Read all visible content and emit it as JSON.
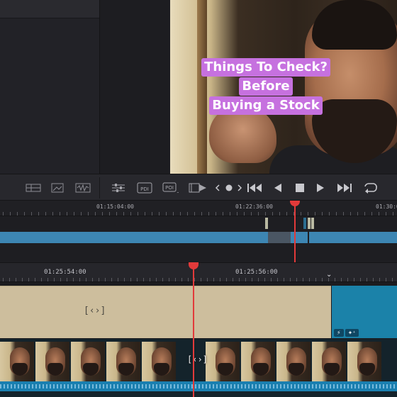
{
  "viewer": {
    "caption_lines": [
      "Things To Check?",
      "Before",
      "Buying a Stock"
    ]
  },
  "toolbar": {
    "left_icons": [
      "layout-icon",
      "image-icon",
      "waveform-icon"
    ],
    "center_icons": [
      "sliders-icon",
      "pdi-icon",
      "poi-icon",
      "film-play-icon"
    ],
    "transport": [
      "prev-marker-icon",
      "marker-dot-icon",
      "next-marker-icon",
      "go-to-start-icon",
      "play-reverse-icon",
      "stop-icon",
      "play-icon",
      "go-to-end-icon",
      "loop-icon"
    ],
    "pdi_label": "PDI",
    "poi_label": "POI"
  },
  "mini_timeline": {
    "timecodes": [
      "01:15:04:00",
      "01:22:36:00",
      "01:30:0"
    ]
  },
  "main_timeline": {
    "timecodes": [
      "01:25:54:00",
      "01:25:56:00"
    ],
    "title_clip_marker": "[‹›]",
    "video_clip_marker": "[‹›]",
    "blue_clip_badges": [
      "⚡",
      "✦⁺"
    ]
  },
  "colors": {
    "caption_bg": "#c671df",
    "playhead": "#e23a3a",
    "clip_blue": "#3d86b3",
    "title_clip": "#cdbe9d"
  }
}
